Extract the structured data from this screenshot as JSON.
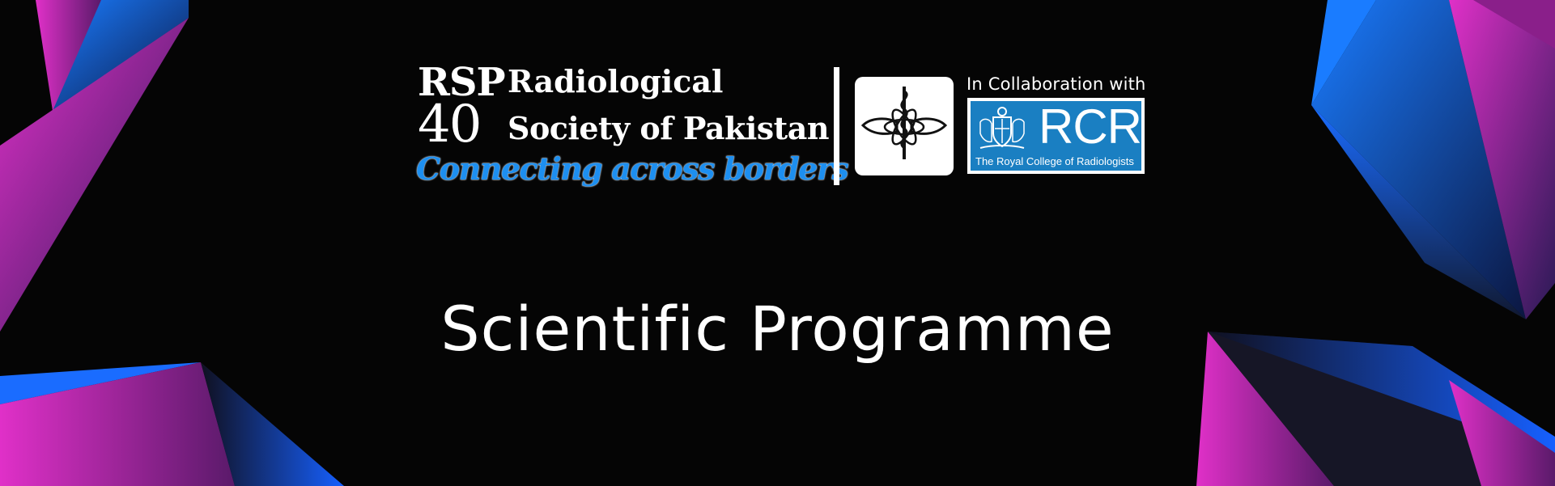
{
  "banner": {
    "background_color": "#050505",
    "accent_colors": [
      "#e030c8",
      "#1060ff",
      "#1a1a2e"
    ]
  },
  "rsp_logo": {
    "abbreviation": "RSP",
    "number": "40",
    "name_line1": "Radiological",
    "name_line2": "Society of Pakistan",
    "tagline": "Connecting across borders",
    "tagline_color": "#1d8ff0"
  },
  "emblem": {
    "icon": "crescent-caduceus-emblem-icon",
    "crescent_color": "#e01b24"
  },
  "collaboration": {
    "label": "In Collaboration with",
    "partner_abbreviation": "RCR",
    "partner_name": "The Royal College of Radiologists",
    "partner_color": "#1a7fc2",
    "crest_icon": "coat-of-arms-icon"
  },
  "title": "Scientific Programme"
}
